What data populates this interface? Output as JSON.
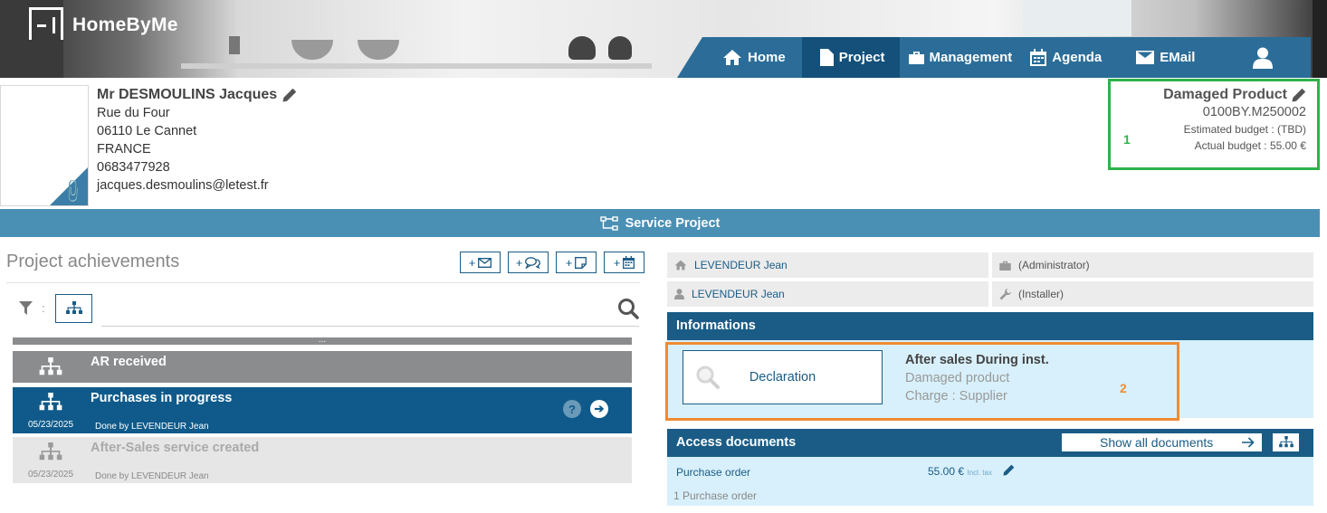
{
  "app": {
    "logo_text": "HomeByMe"
  },
  "nav": {
    "items": [
      {
        "label": "Home",
        "icon": "home-icon"
      },
      {
        "label": "Project",
        "icon": "document-icon",
        "active": true
      },
      {
        "label": "Management",
        "icon": "briefcase-icon"
      },
      {
        "label": "Agenda",
        "icon": "calendar-icon"
      },
      {
        "label": "EMail",
        "icon": "envelope-icon"
      },
      {
        "label": "",
        "icon": "user-icon"
      }
    ]
  },
  "client": {
    "name": "Mr DESMOULINS Jacques",
    "street": "Rue du Four",
    "city": "06110 Le Cannet",
    "country": "FRANCE",
    "phone": "0683477928",
    "email": "jacques.desmoulins@letest.fr"
  },
  "dossier": {
    "title": "Damaged Product",
    "reference": "0100BY.M250002",
    "estimated_budget": "Estimated budget : (TBD)",
    "actual_budget": "Actual budget : 55.00 €",
    "marker": "1"
  },
  "service_bar": {
    "label": "Service Project"
  },
  "achievements": {
    "title": "Project achievements",
    "buttons": [
      "+",
      "+",
      "+",
      "+"
    ],
    "filter_colon": ":",
    "progress_dots": "...",
    "steps": [
      {
        "label": "AR received",
        "date": "",
        "done_by": ""
      },
      {
        "label": "Purchases in progress",
        "date": "05/23/2025",
        "done_by": "Done by LEVENDEUR Jean",
        "help": "?",
        "go": "➔"
      },
      {
        "label": "After-Sales service created",
        "date": "05/23/2025",
        "done_by": "Done by LEVENDEUR Jean"
      }
    ]
  },
  "actors": [
    {
      "name": "LEVENDEUR Jean",
      "role": "(Administrator)"
    },
    {
      "name": "LEVENDEUR Jean",
      "role": "(Installer)"
    }
  ],
  "informations": {
    "title": "Informations",
    "declaration_label": "Declaration",
    "heading": "After sales During inst.",
    "line1": "Damaged product",
    "line2": "Charge : Supplier",
    "marker": "2"
  },
  "documents": {
    "title": "Access documents",
    "show_all_label": "Show all documents",
    "rows": [
      {
        "name": "Purchase order",
        "amount": "55.00 €",
        "tax_note": "Incl. tax"
      }
    ],
    "count_label": "1 Purchase order"
  },
  "colors": {
    "nav_bg": "#2b6d98",
    "nav_active": "#14507a",
    "accent_dark": "#1a5c86",
    "service_bar": "#4a90b4",
    "highlight_green": "#2db34a",
    "highlight_orange": "#ef8b33",
    "panel_light_blue": "#d8f0fb"
  }
}
